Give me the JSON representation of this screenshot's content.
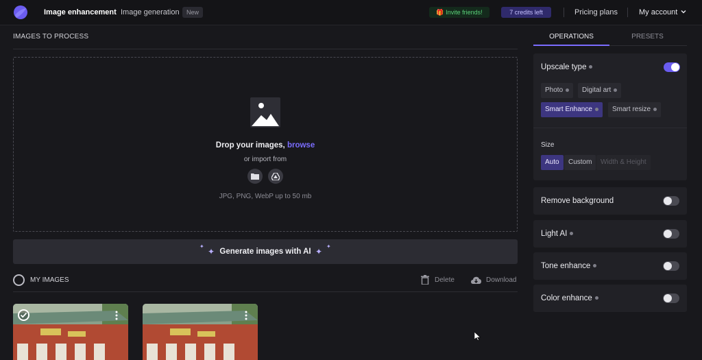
{
  "nav": {
    "image_enhancement": "Image enhancement",
    "image_generation": "Image generation",
    "new_badge": "New",
    "invite": "🎁 Invite friends!",
    "credits": "7 credits left",
    "pricing": "Pricing plans",
    "account": "My account"
  },
  "process": {
    "title": "IMAGES TO PROCESS",
    "drop_prefix": "Drop your images, ",
    "drop_browse": "browse",
    "import_from": "or import from",
    "formats": "JPG, PNG, WebP up to 50 mb",
    "generate_ai": "Generate images with AI"
  },
  "my_images": {
    "title": "MY IMAGES",
    "delete": "Delete",
    "download": "Download"
  },
  "panel": {
    "tabs": [
      "OPERATIONS",
      "PRESETS"
    ],
    "upscale": {
      "title": "Upscale type",
      "enabled": true,
      "types": [
        "Photo",
        "Digital art",
        "Smart Enhance",
        "Smart resize"
      ],
      "selected_type": "Smart Enhance",
      "size_label": "Size",
      "size_options": [
        "Auto",
        "Custom"
      ],
      "selected_size": "Auto",
      "size_placeholder": "Width & Height"
    },
    "remove_background": {
      "title": "Remove background",
      "enabled": false
    },
    "light_ai": {
      "title": "Light AI",
      "enabled": false
    },
    "tone_enhance": {
      "title": "Tone enhance",
      "enabled": false
    },
    "color_enhance": {
      "title": "Color enhance",
      "enabled": false
    }
  },
  "colors": {
    "accent": "#7b6dff",
    "background": "#18181c",
    "card": "#212126"
  }
}
